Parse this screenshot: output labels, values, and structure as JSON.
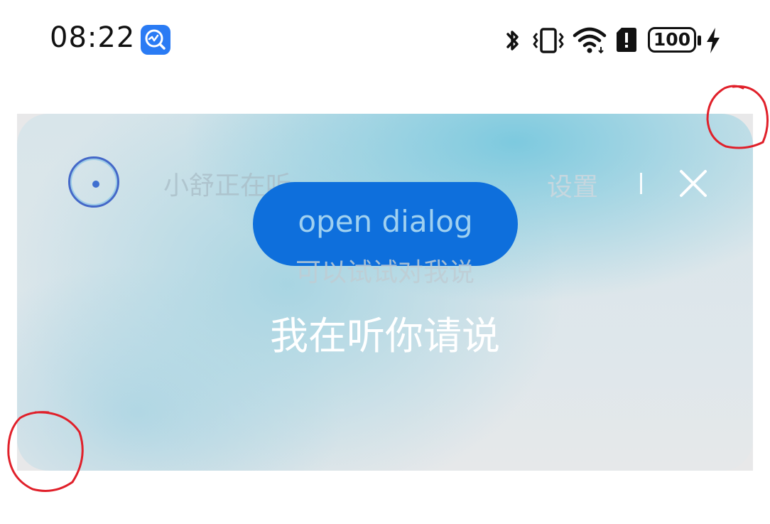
{
  "status_bar": {
    "time": "08:22",
    "battery": "100",
    "icons": [
      "app-notification-icon",
      "bluetooth-icon",
      "vibrate-icon",
      "wifi-icon",
      "sim-alert-icon",
      "battery-icon",
      "charging-icon"
    ]
  },
  "dialog": {
    "status_text": "小舒正在听...",
    "settings_label": "设置",
    "open_dialog_label": "open dialog",
    "hint_text": "可以试试对我说",
    "main_prompt": "我在听你请说",
    "colors": {
      "button": "#0e6fdc",
      "accent_ring": "#4468c8",
      "annotation": "#e0202a"
    }
  }
}
